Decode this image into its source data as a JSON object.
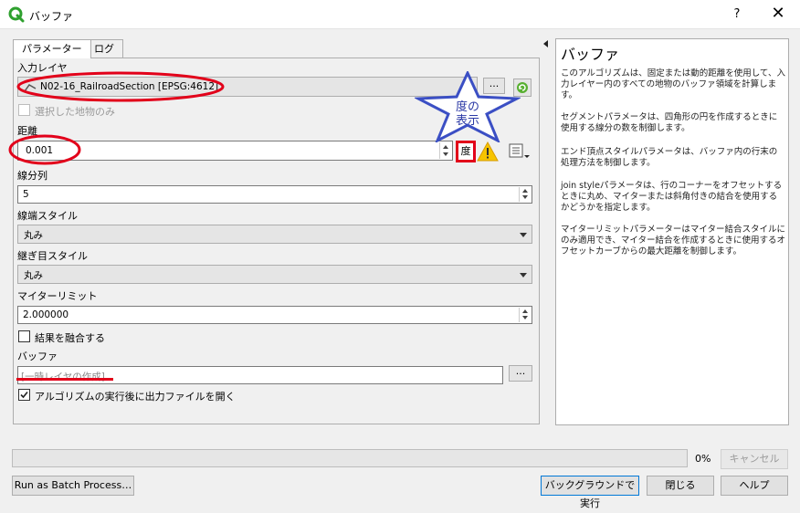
{
  "window": {
    "title": "バッファ",
    "help_label": "?",
    "close_label": "✕",
    "accent": "#2ea02e"
  },
  "tabs": [
    {
      "label": "パラメーター"
    },
    {
      "label": "ログ"
    }
  ],
  "params": {
    "input_layer_label": "入力レイヤ",
    "input_layer_value": "N02-16_RailroadSection [EPSG:4612]",
    "selected_only_label": "選択した地物のみ",
    "distance_label": "距離",
    "distance_value": "0.001",
    "distance_unit": "度",
    "segments_label": "線分列",
    "segments_value": "5",
    "end_cap_label": "線端スタイル",
    "end_cap_value": "丸み",
    "join_label": "継ぎ目スタイル",
    "join_value": "丸み",
    "miter_label": "マイターリミット",
    "miter_value": "2.000000",
    "dissolve_label": "結果を融合する",
    "output_label": "バッファ",
    "output_placeholder": "[一時レイヤの作成]",
    "open_output_label": "アルゴリズムの実行後に出力ファイルを開く",
    "ellipsis": "..."
  },
  "annotation": {
    "star_text_line1": "度の",
    "star_text_line2": "表示",
    "star_color": "#3b4fc4",
    "highlight_color": "#e2001a"
  },
  "help": {
    "title": "バッファ",
    "p1": "このアルゴリズムは、固定または動的距離を使用して、入力レイヤー内のすべての地物のバッファ領域を計算します。",
    "p2": "セグメントパラメータは、四角形の円を作成するときに使用する線分の数を制御します。",
    "p3": "エンド頂点スタイルパラメータは、バッファ内の行末の処理方法を制御します。",
    "p4": "join styleパラメータは、行のコーナーをオフセットするときに丸め、マイターまたは斜角付きの結合を使用するかどうかを指定します。",
    "p5": "マイターリミットパラメーターはマイター結合スタイルにのみ適用でき、マイター結合を作成するときに使用するオフセットカーブからの最大距離を制御します。"
  },
  "footer": {
    "progress_percent": 0,
    "progress_text": "0%",
    "cancel_label": "キャンセル",
    "batch_label": "Run as Batch Process…",
    "run_bg_label": "バックグラウンドで実行",
    "close_label": "閉じる",
    "help_label": "ヘルプ"
  }
}
